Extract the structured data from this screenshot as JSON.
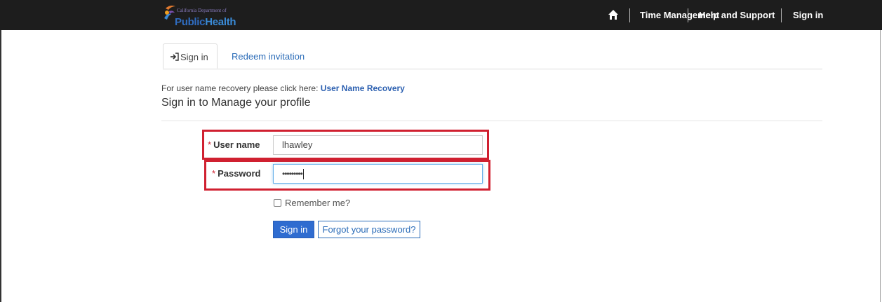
{
  "header": {
    "logo_small": "California Department of",
    "logo_big_1": "Public",
    "logo_big_2": "Health",
    "nav": [
      {
        "label": "Time Management"
      },
      {
        "label": "Help and Support"
      },
      {
        "label": "Sign in"
      }
    ]
  },
  "tabs": [
    {
      "label": "Sign in",
      "active": true
    },
    {
      "label": "Redeem invitation",
      "active": false
    }
  ],
  "recovery": {
    "prefix": "For user name recovery please click here:",
    "link": "User Name Recovery"
  },
  "heading": "Sign in to Manage your profile",
  "form": {
    "username_label": "User name",
    "username_value": "lhawley",
    "password_label": "Password",
    "password_value": "•••••••••",
    "required_mark": "*",
    "remember_label": "Remember me?",
    "signin_button": "Sign in",
    "forgot_button": "Forgot your password?"
  },
  "colors": {
    "topbar": "#1d1d1d",
    "highlight": "#d02030",
    "primary": "#2f6cd0",
    "link": "#2b6cb8"
  }
}
